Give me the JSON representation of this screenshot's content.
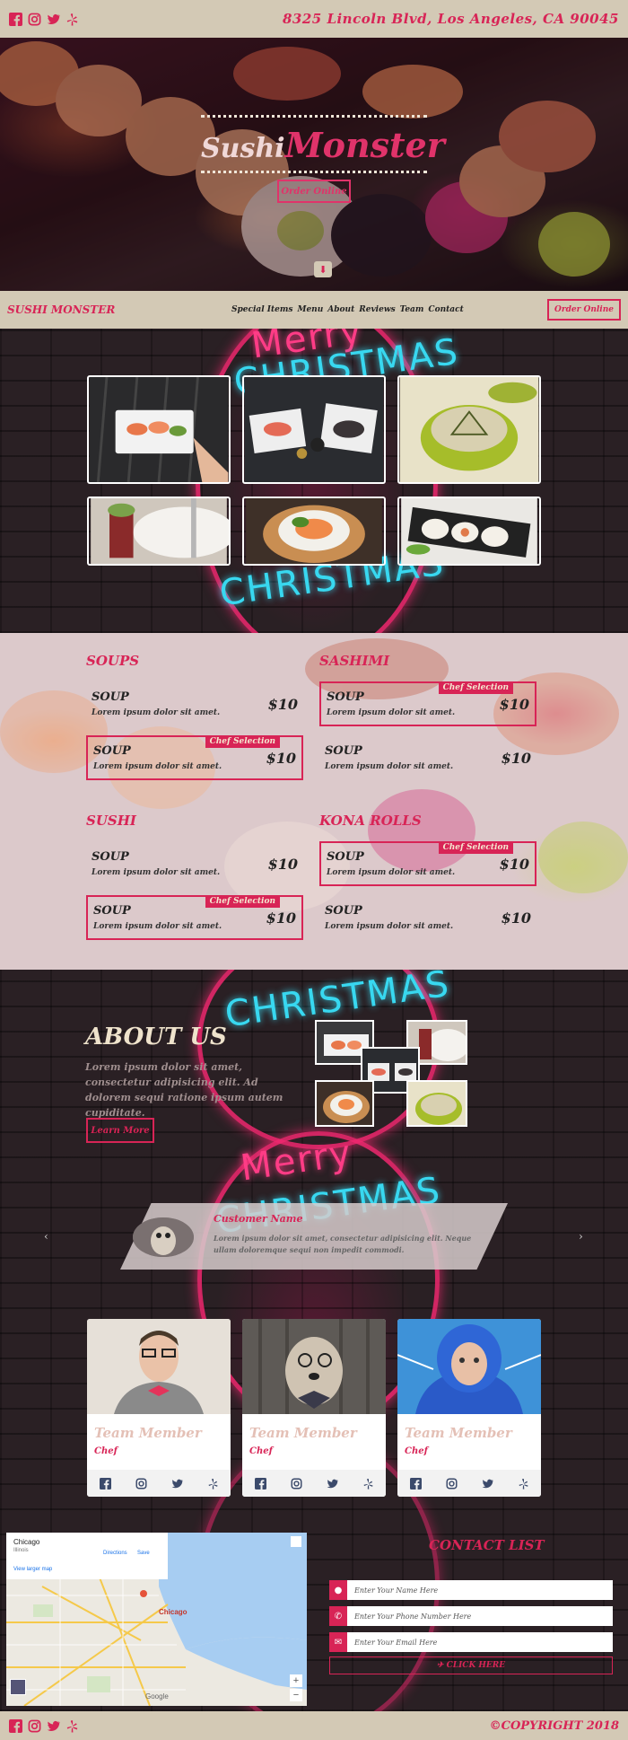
{
  "topbar": {
    "address": "8325 Lincoln Blvd, Los Angeles, CA 90045",
    "social_icons": [
      "facebook-icon",
      "instagram-icon",
      "twitter-icon",
      "yelp-icon"
    ]
  },
  "hero": {
    "title_small": "Sushi",
    "title_big": "Monster",
    "button": "Order Online",
    "arrow": "⬇"
  },
  "nav": {
    "brand": "SUSHI MONSTER",
    "links": [
      "Special Items",
      "Menu",
      "About",
      "Reviews",
      "Team",
      "Contact"
    ],
    "order": "Order Online"
  },
  "neon_words": {
    "merry": "Merry",
    "christmas": "CHRISTMAS"
  },
  "menu": {
    "sections": [
      {
        "title": "SOUPS",
        "items": [
          {
            "name": "SOUP",
            "desc": "Lorem ipsum dolor sit amet.",
            "price": "$10",
            "badge": ""
          },
          {
            "name": "SOUP",
            "desc": "Lorem ipsum dolor sit amet.",
            "price": "$10",
            "badge": "Chef Selection"
          }
        ]
      },
      {
        "title": "SASHIMI",
        "items": [
          {
            "name": "SOUP",
            "desc": "Lorem ipsum dolor sit amet.",
            "price": "$10",
            "badge": "Chef Selection"
          },
          {
            "name": "SOUP",
            "desc": "Lorem ipsum dolor sit amet.",
            "price": "$10",
            "badge": ""
          }
        ]
      },
      {
        "title": "SUSHI",
        "items": [
          {
            "name": "SOUP",
            "desc": "Lorem ipsum dolor sit amet.",
            "price": "$10",
            "badge": ""
          },
          {
            "name": "SOUP",
            "desc": "Lorem ipsum dolor sit amet.",
            "price": "$10",
            "badge": "Chef Selection"
          }
        ]
      },
      {
        "title": "KONA ROLLS",
        "items": [
          {
            "name": "SOUP",
            "desc": "Lorem ipsum dolor sit amet.",
            "price": "$10",
            "badge": "Chef Selection"
          },
          {
            "name": "SOUP",
            "desc": "Lorem ipsum dolor sit amet.",
            "price": "$10",
            "badge": ""
          }
        ]
      }
    ]
  },
  "about": {
    "title": "ABOUT US",
    "text": "Lorem ipsum dolor sit amet, consectetur adipisicing elit. Ad dolorem sequi ratione ipsum autem cupiditate.",
    "button": "Learn More"
  },
  "testimonial": {
    "name": "Customer Name",
    "text": "Lorem ipsum dolor sit amet, consectetur adipisicing elit. Neque ullam doloremque sequi non impedit commodi.",
    "prev": "‹",
    "next": "›"
  },
  "team": [
    {
      "name": "Team Member",
      "role": "Chef"
    },
    {
      "name": "Team Member",
      "role": "Chef"
    },
    {
      "name": "Team Member",
      "role": "Chef"
    }
  ],
  "map": {
    "city": "Chicago",
    "state": "Illinois",
    "directions": "Directions",
    "save": "Save",
    "larger": "View larger map",
    "label": "Chicago",
    "google": "Google"
  },
  "contact": {
    "title": "CONTACT LIST",
    "name_placeholder": "Enter Your Name Here",
    "phone_placeholder": "Enter Your Phone Number Here",
    "email_placeholder": "Enter Your Email Here",
    "submit": "CLICK HERE"
  },
  "footer": {
    "copyright": "©COPYRIGHT 2018"
  },
  "colors": {
    "accent": "#d82456",
    "bar": "#d3c9b5",
    "menu_bg": "#dcc9cb"
  }
}
